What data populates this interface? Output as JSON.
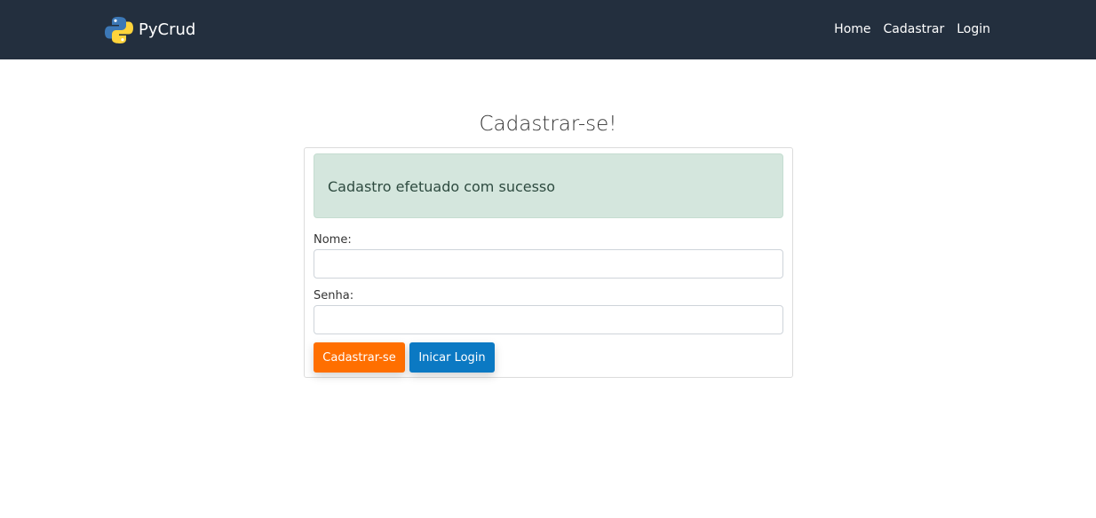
{
  "navbar": {
    "brand": "PyCrud",
    "logo_icon": "python-logo-icon",
    "links": [
      "Home",
      "Cadastrar",
      "Login"
    ],
    "background": "#232f3e"
  },
  "main": {
    "title": "Cadastrar-se!",
    "alert": {
      "message": "Cadastro efetuado com sucesso",
      "color": "#d4e6dd"
    },
    "form": {
      "name_label": "Nome:",
      "name_value": "",
      "password_label": "Senha:",
      "password_value": "",
      "signup_button": "Cadastrar-se",
      "login_button": "Inicar Login"
    }
  },
  "colors": {
    "signup_button": "#ff6f00",
    "login_button": "#0b79c3"
  }
}
